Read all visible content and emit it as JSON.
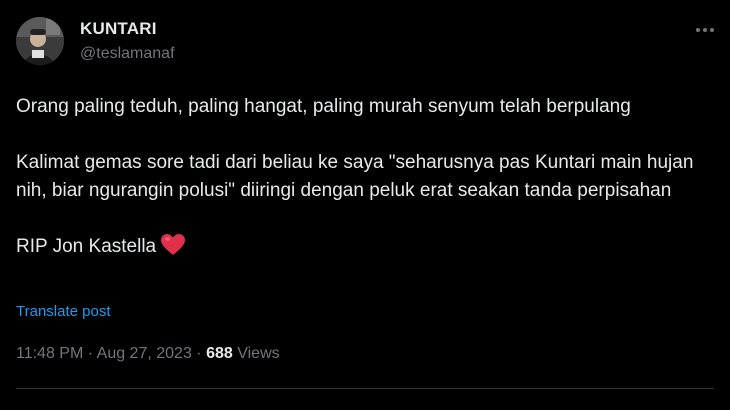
{
  "author": {
    "display_name": "KUNTARI",
    "handle": "@teslamanaf",
    "avatar_icon": "profile-photo"
  },
  "post": {
    "paragraphs": [
      "Orang paling teduh, paling hangat, paling murah senyum telah berpulang",
      "Kalimat gemas sore tadi dari beliau ke saya \"seharusnya pas Kuntari main hujan nih, biar ngurangin polusi\" diiringi dengan peluk erat seakan tanda perpisahan"
    ],
    "closing_text": "RIP Jon Kastella",
    "closing_emoji_icon": "red-heart-icon"
  },
  "translate_label": "Translate post",
  "meta": {
    "time": "11:48 PM",
    "separator": "·",
    "date": "Aug 27, 2023",
    "views_count": "688",
    "views_label": "Views"
  },
  "colors": {
    "background": "#000000",
    "text": "#e7e9ea",
    "secondary_text": "#71767b",
    "link": "#1d9bf0",
    "heart": "#f91880"
  }
}
